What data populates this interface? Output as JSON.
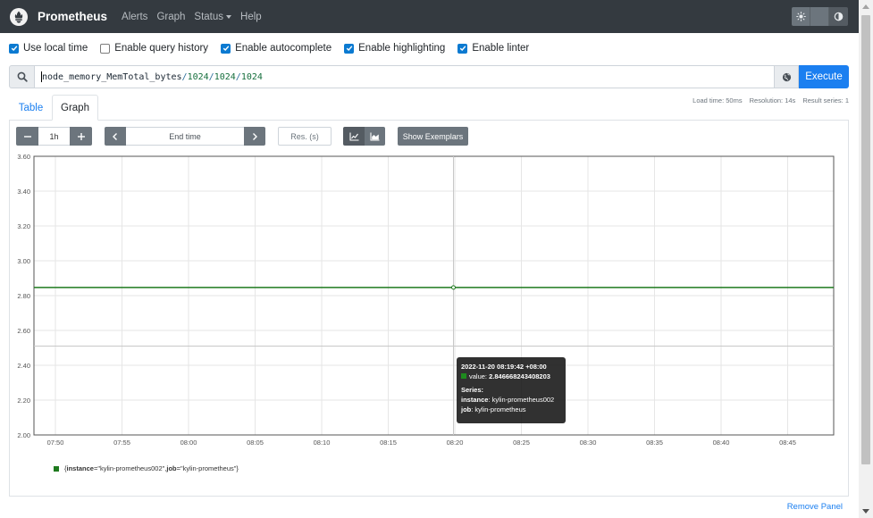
{
  "navbar": {
    "brand": "Prometheus",
    "links": [
      {
        "label": "Alerts"
      },
      {
        "label": "Graph"
      },
      {
        "label": "Status"
      },
      {
        "label": "Help"
      }
    ]
  },
  "options": {
    "use_local_time": {
      "label": "Use local time",
      "checked": true
    },
    "enable_query_history": {
      "label": "Enable query history",
      "checked": false
    },
    "enable_autocomplete": {
      "label": "Enable autocomplete",
      "checked": true
    },
    "enable_highlighting": {
      "label": "Enable highlighting",
      "checked": true
    },
    "enable_linter": {
      "label": "Enable linter",
      "checked": true
    }
  },
  "query": {
    "metric": "node_memory_MemTotal_bytes",
    "op1": "/",
    "num1": "1024",
    "op2": "/",
    "num2": "1024",
    "op3": "/",
    "num3": "1024",
    "execute_label": "Execute"
  },
  "tabs": {
    "table": "Table",
    "graph": "Graph"
  },
  "stats": {
    "load_time": "Load time: 50ms",
    "resolution": "Resolution: 14s",
    "result_series": "Result series: 1"
  },
  "controls": {
    "range_minus": "−",
    "range_value": "1h",
    "range_plus": "+",
    "end_time_placeholder": "End time",
    "resolution_placeholder": "Res. (s)",
    "show_exemplars": "Show Exemplars"
  },
  "chart_data": {
    "type": "line",
    "yticks": [
      "3.60",
      "3.40",
      "3.20",
      "3.00",
      "2.80",
      "2.60",
      "2.40",
      "2.20",
      "2.00"
    ],
    "ylim": [
      2.0,
      3.6
    ],
    "xticks": [
      "07:50",
      "07:55",
      "08:00",
      "08:05",
      "08:10",
      "08:15",
      "08:20",
      "08:25",
      "08:30",
      "08:35",
      "08:40",
      "08:45"
    ],
    "series": [
      {
        "name": "{instance=\"kylin-prometheus002\", job=\"kylin-prometheus\"}",
        "color": "#1e7a1e",
        "constant_value": 2.846668243408203
      }
    ],
    "hover": {
      "time_label": "08:20",
      "value": 2.846668243408203
    }
  },
  "legend": {
    "open": "{",
    "instance_key": "instance",
    "instance_val": "=\"kylin-prometheus002\", ",
    "job_key": "job",
    "job_val": "=\"kylin-prometheus\"}"
  },
  "tooltip": {
    "timestamp": "2022-11-20 08:19:42 +08:00",
    "value_label": "value:",
    "value": "2.846668243408203",
    "series_label": "Series:",
    "instance_label": "instance",
    "instance_value": ": kylin-prometheus002",
    "job_label": "job",
    "job_value": ": kylin-prometheus"
  },
  "panel": {
    "remove_label": "Remove Panel"
  }
}
